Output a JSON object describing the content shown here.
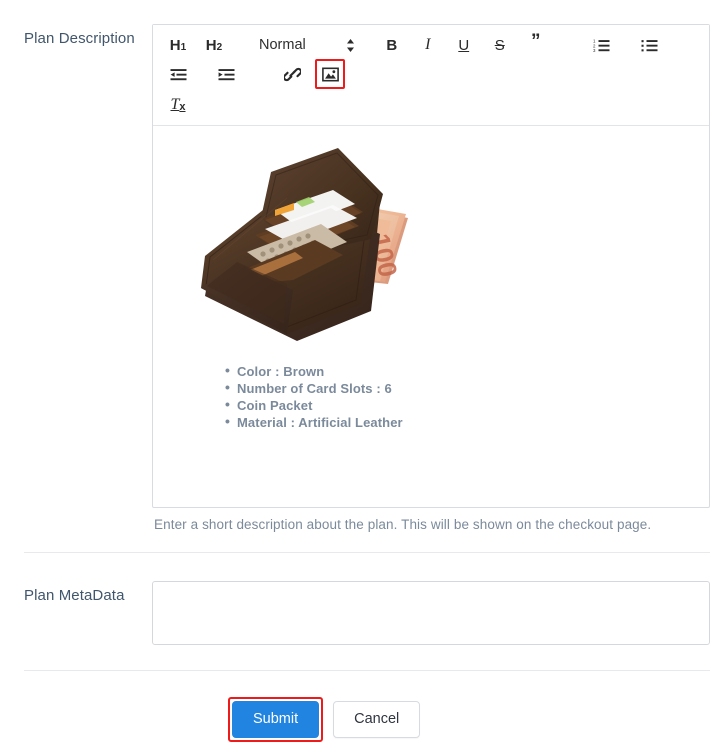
{
  "form": {
    "description_field": {
      "label": "Plan Description",
      "help_text": "Enter a short description about the plan. This will be shown on the checkout page.",
      "toolbar": {
        "h1_label": "H",
        "h1_sub": "1",
        "h2_label": "H",
        "h2_sub": "2",
        "format_select_value": "Normal",
        "bold_label": "B",
        "italic_label": "I",
        "underline_label": "U",
        "strikethrough_label": "S",
        "blockquote_label": "”",
        "clear_format_label": "T",
        "clear_format_sub": "x",
        "icons": {
          "format_caret": "chevron-updown-icon",
          "ordered_list": "ordered-list-icon",
          "bullet_list": "bullet-list-icon",
          "outdent": "outdent-icon",
          "indent": "indent-icon",
          "link": "link-icon",
          "image": "image-icon"
        },
        "highlighted_button": "image-icon"
      },
      "content": {
        "image_alt": "brown-leather-wallet",
        "bullets": [
          "Color : Brown",
          "Number of Card Slots : 6",
          "Coin Packet",
          "Material : Artificial Leather"
        ]
      }
    },
    "metadata_field": {
      "label": "Plan MetaData",
      "value": "",
      "placeholder": ""
    },
    "actions": {
      "submit_label": "Submit",
      "cancel_label": "Cancel",
      "highlighted_button": "submit-button"
    }
  },
  "colors": {
    "label_text": "#41566d",
    "help_text": "#7b8a9b",
    "bullet_text": "#7b8a9b",
    "primary_button": "#2184e0",
    "highlight_border": "#ef1b1b",
    "editor_border": "#d8dce0",
    "divider": "#e7e9ec"
  }
}
